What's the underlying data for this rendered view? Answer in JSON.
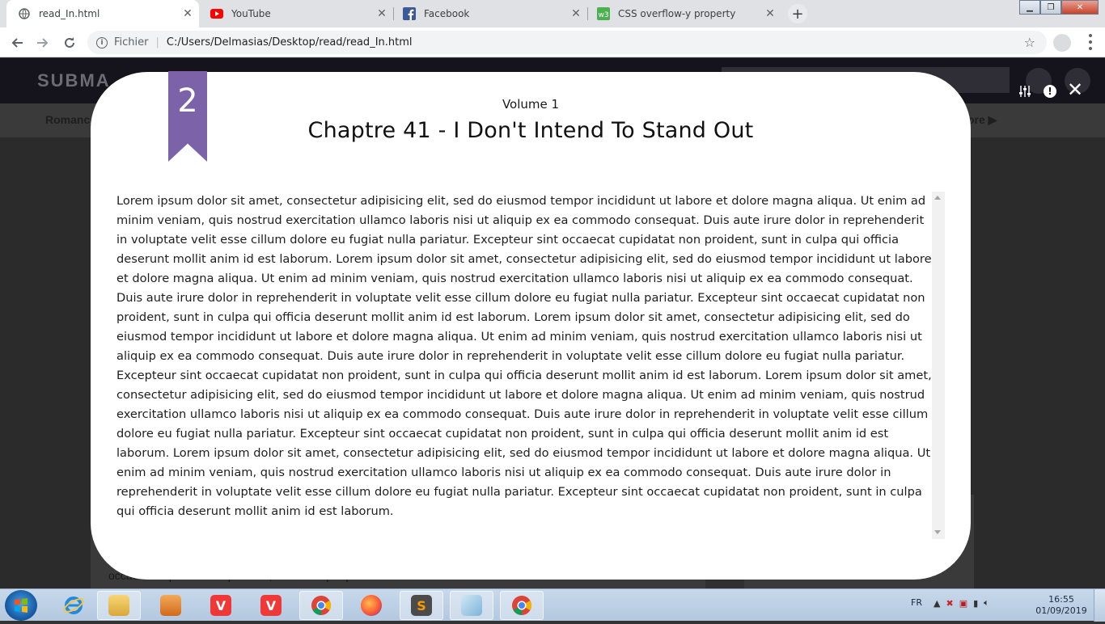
{
  "browser": {
    "tabs": [
      {
        "title": "read_In.html",
        "active": true,
        "icon": "globe-icon"
      },
      {
        "title": "YouTube",
        "active": false,
        "icon": "youtube-icon"
      },
      {
        "title": "Facebook",
        "active": false,
        "icon": "facebook-icon"
      },
      {
        "title": "CSS overflow-y property",
        "active": false,
        "icon": "w3schools-icon"
      }
    ],
    "omnibox": {
      "scheme_label": "Fichier",
      "url": "C:/Users/Delmasias/Desktop/read/read_In.html"
    }
  },
  "page": {
    "logo_text": "SUBMA",
    "subnav_left": "Romanc",
    "subnav_right": "ore ▶",
    "card_text": "occaecat cupidatat non proident, sunt in culpa qui officia deserunt mollit anim id est laborum."
  },
  "reader": {
    "chapter_badge": "2",
    "volume": "Volume 1",
    "chapter_title": "Chaptre 41 - I Don't Intend To Stand Out",
    "body": "Lorem ipsum dolor sit amet, consectetur adipisicing elit, sed do eiusmod tempor incididunt ut labore et dolore magna aliqua. Ut enim ad minim veniam, quis nostrud exercitation ullamco laboris nisi ut aliquip ex ea commodo consequat. Duis aute irure dolor in reprehenderit in voluptate velit esse cillum dolore eu fugiat nulla pariatur. Excepteur sint occaecat cupidatat non proident, sunt in culpa qui officia deserunt mollit anim id est laborum. Lorem ipsum dolor sit amet, consectetur adipisicing elit, sed do eiusmod tempor incididunt ut labore et dolore magna aliqua. Ut enim ad minim veniam, quis nostrud exercitation ullamco laboris nisi ut aliquip ex ea commodo consequat. Duis aute irure dolor in reprehenderit in voluptate velit esse cillum dolore eu fugiat nulla pariatur. Excepteur sint occaecat cupidatat non proident, sunt in culpa qui officia deserunt mollit anim id est laborum. Lorem ipsum dolor sit amet, consectetur adipisicing elit, sed do eiusmod tempor incididunt ut labore et dolore magna aliqua. Ut enim ad minim veniam, quis nostrud exercitation ullamco laboris nisi ut aliquip ex ea commodo consequat. Duis aute irure dolor in reprehenderit in voluptate velit esse cillum dolore eu fugiat nulla pariatur. Excepteur sint occaecat cupidatat non proident, sunt in culpa qui officia deserunt mollit anim id est laborum. Lorem ipsum dolor sit amet, consectetur adipisicing elit, sed do eiusmod tempor incididunt ut labore et dolore magna aliqua. Ut enim ad minim veniam, quis nostrud exercitation ullamco laboris nisi ut aliquip ex ea commodo consequat. Duis aute irure dolor in reprehenderit in voluptate velit esse cillum dolore eu fugiat nulla pariatur. Excepteur sint occaecat cupidatat non proident, sunt in culpa qui officia deserunt mollit anim id est laborum. Lorem ipsum dolor sit amet, consectetur adipisicing elit, sed do eiusmod tempor incididunt ut labore et dolore magna aliqua. Ut enim ad minim veniam, quis nostrud exercitation ullamco laboris nisi ut aliquip ex ea commodo consequat. Duis aute irure dolor in reprehenderit in voluptate velit esse cillum dolore eu fugiat nulla pariatur. Excepteur sint occaecat cupidatat non proident, sunt in culpa qui officia deserunt mollit anim id est laborum.",
    "accent_color": "#7c62a8"
  },
  "taskbar": {
    "language": "FR",
    "time": "16:55",
    "date": "01/09/2019",
    "apps": [
      "ie-icon",
      "explorer-icon",
      "media-player-icon",
      "vivaldi-icon",
      "vivaldi-icon",
      "chrome-icon",
      "firefox-icon",
      "sublime-text-icon",
      "notepad-icon",
      "chrome-icon"
    ]
  }
}
